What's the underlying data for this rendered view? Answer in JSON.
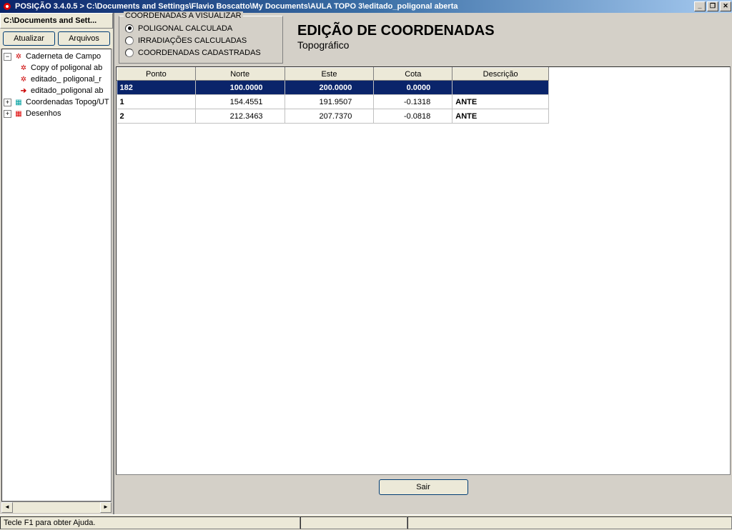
{
  "window": {
    "title": "POSIÇÃO 3.4.0.5 > C:\\Documents and Settings\\Flavio Boscatto\\My Documents\\AULA TOPO 3\\editado_poligonal aberta",
    "min_label": "_",
    "max_label": "❐",
    "close_label": "✕"
  },
  "sidebar": {
    "header": "C:\\Documents and Sett...",
    "btn_atualizar": "Atualizar",
    "btn_arquivos": "Arquivos",
    "tree": {
      "root": "Caderneta de Campo",
      "items": [
        "Copy of poligonal ab",
        "editado_ poligonal_r",
        "editado_poligonal ab"
      ],
      "coord": "Coordenadas Topog/UT",
      "desenhos": "Desenhos"
    }
  },
  "coord_group": {
    "legend": "COORDENADAS A VISUALIZAR",
    "opt1": "POLIGONAL CALCULADA",
    "opt2": "IRRADIAÇÕES CALCULADAS",
    "opt3": "COORDENADAS CADASTRADAS"
  },
  "heading": {
    "title": "EDIÇÃO DE COORDENADAS",
    "subtitle": "Topográfico"
  },
  "table": {
    "headers": {
      "ponto": "Ponto",
      "norte": "Norte",
      "este": "Este",
      "cota": "Cota",
      "desc": "Descrição"
    },
    "rows": [
      {
        "ponto": "182",
        "norte": "100.0000",
        "este": "200.0000",
        "cota": "0.0000",
        "desc": "",
        "selected": true
      },
      {
        "ponto": "1",
        "norte": "154.4551",
        "este": "191.9507",
        "cota": "-0.1318",
        "desc": "ANTE",
        "selected": false
      },
      {
        "ponto": "2",
        "norte": "212.3463",
        "este": "207.7370",
        "cota": "-0.0818",
        "desc": "ANTE",
        "selected": false
      }
    ]
  },
  "buttons": {
    "sair": "Sair"
  },
  "statusbar": {
    "help": "Tecle F1 para obter Ajuda."
  }
}
